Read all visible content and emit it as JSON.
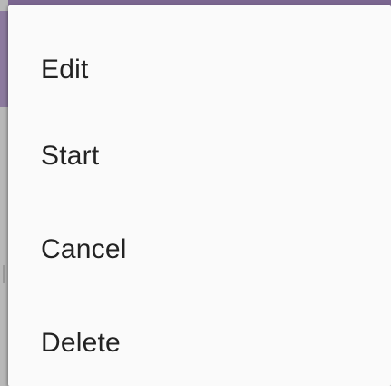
{
  "menu": {
    "items": [
      {
        "label": "Edit"
      },
      {
        "label": "Start"
      },
      {
        "label": "Cancel"
      },
      {
        "label": "Delete"
      }
    ]
  },
  "colors": {
    "top_bar": "#7b6690",
    "menu_background": "#fafafa",
    "text": "#222222"
  }
}
